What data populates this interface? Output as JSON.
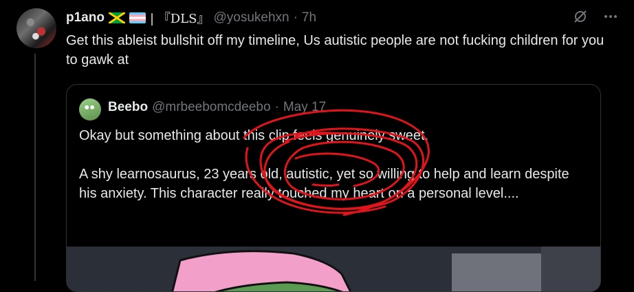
{
  "tweet": {
    "author_name": "p1ano",
    "display_name_suffix": "| 『DLS』",
    "handle": "@yosukehxn",
    "separator": "·",
    "time": "7h",
    "text": "Get this ableist bullshit off my timeline, Us autistic people are not fucking children for you to gawk at",
    "icons": [
      "grok-icon",
      "more-icon"
    ]
  },
  "quoted_tweet": {
    "author_name": "Beebo",
    "handle": "@mrbeebomcdeebo",
    "separator": "·",
    "date": "May 17",
    "text": "Okay but something about this clip feels genuinely sweet.\n\nA shy learnosaurus, 23 years old, autistic, yet so willing to help and learn despite his anxiety. This character really touched my heart on a personal level...."
  },
  "colors": {
    "background": "#000000",
    "text": "#e7e9ea",
    "secondary_text": "#71767b",
    "border": "#2f3336",
    "annotation": "#e0151c"
  }
}
